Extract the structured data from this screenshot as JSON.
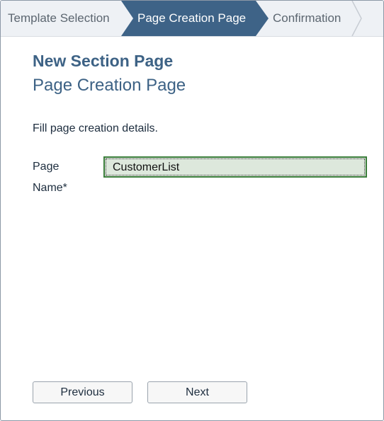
{
  "wizard": {
    "steps": [
      {
        "label": "Template Selection",
        "state": "completed"
      },
      {
        "label": "Page Creation Page",
        "state": "active"
      },
      {
        "label": "Confirmation",
        "state": "pending"
      }
    ]
  },
  "page": {
    "title": "New Section Page",
    "subtitle": "Page Creation Page",
    "instruction": "Fill page creation details."
  },
  "form": {
    "page_name": {
      "label_line1": "Page",
      "label_line2": "Name*",
      "value": "CustomerList"
    }
  },
  "footer": {
    "previous_label": "Previous",
    "next_label": "Next"
  },
  "colors": {
    "active_step": "#3e6387",
    "heading": "#3d6285",
    "input_border": "#3a7d3a",
    "input_background": "#dde8dc"
  }
}
